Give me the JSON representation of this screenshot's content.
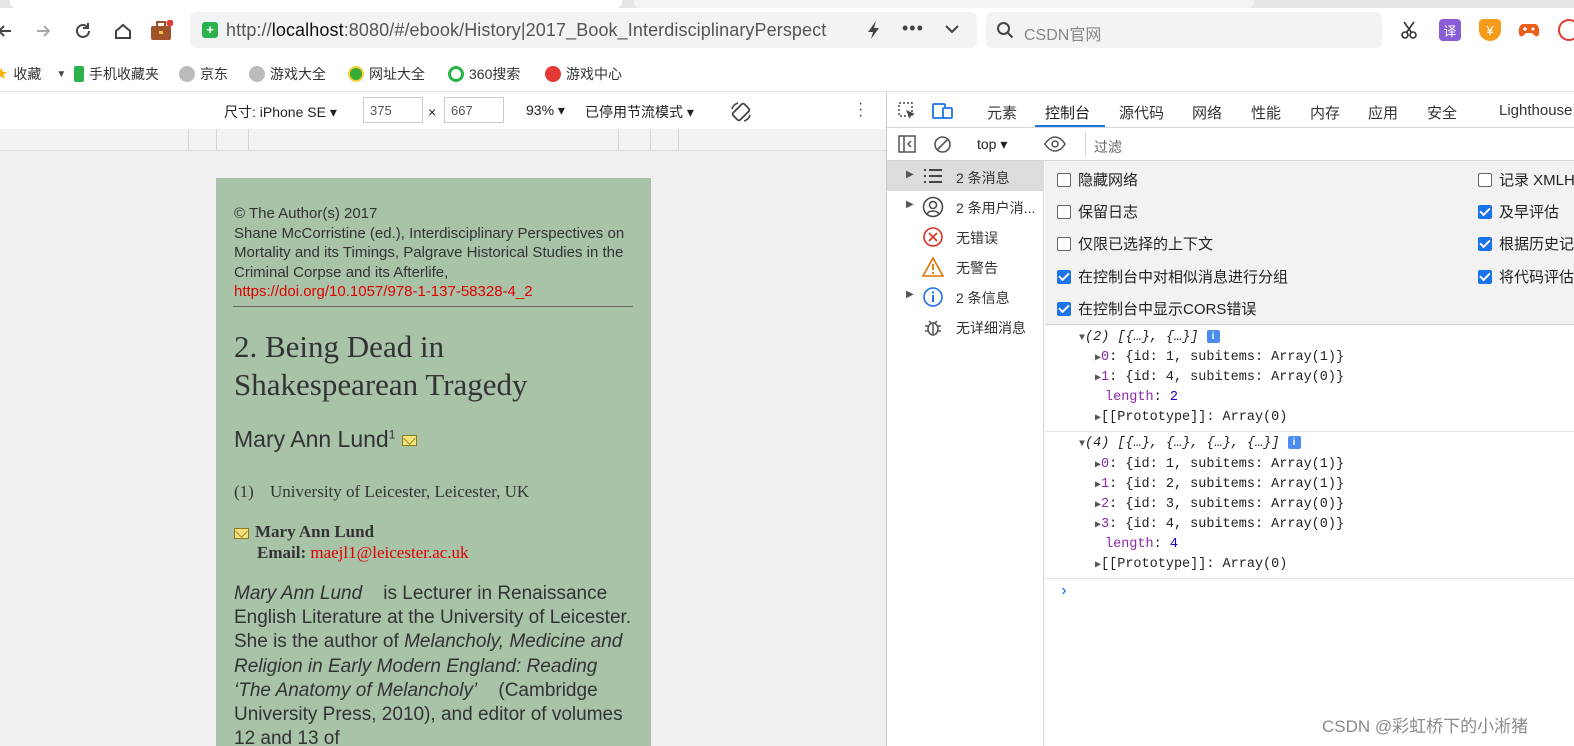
{
  "browser": {
    "url_prefix": "http://",
    "url_host": "localhost",
    "url_rest": ":8080/#/ebook/History|2017_Book_InterdisciplinaryPerspect",
    "search_placeholder": "CSDN官网",
    "ext_translate": "译"
  },
  "bookmarks": [
    "收藏",
    "手机收藏夹",
    "京东",
    "游戏大全",
    "网址大全",
    "360搜索",
    "游戏中心"
  ],
  "device_toolbar": {
    "size_label": "尺寸: iPhone SE ▾",
    "width": "375",
    "x": "×",
    "height": "667",
    "zoom": "93% ▾",
    "throttle": "已停用节流模式 ▾"
  },
  "page": {
    "copyright": "© The Author(s) 2017",
    "citation": "Shane McCorristine (ed.), Interdisciplinary Perspectives on Mortality and its Timings, Palgrave Historical Studies in the Criminal Corpse and its Afterlife,",
    "doi": "https://doi.org/10.1057/978-1-137-58328-4_2",
    "chapter_title": "2. Being Dead in Shakespearean Tragedy",
    "author": "Mary Ann Lund",
    "author_sup": "1",
    "affil_num": "(1)",
    "affiliation": "University of Leicester, Leicester, UK",
    "contact_name": "Mary Ann Lund",
    "email_label": "Email:",
    "email": "maejl1@leicester.ac.uk",
    "bio_name": "Mary Ann Lund",
    "bio_text1": "is Lecturer in Renaissance English Literature at the University of Leicester. She is the author of",
    "bio_book": "Melancholy, Medicine and Religion in Early Modern England: Reading",
    "bio_book2": "‘The Anatomy of Melancholy’",
    "bio_text2": "(Cambridge University Press, 2010), and editor of volumes 12 and 13 of"
  },
  "devtools": {
    "tabs": [
      "元素",
      "控制台",
      "源代码",
      "网络",
      "性能",
      "内存",
      "应用",
      "安全",
      "Lighthouse"
    ],
    "context": "top ▾",
    "filter_placeholder": "过滤",
    "sidebar": [
      "2 条消息",
      "2 条用户消...",
      "无错误",
      "无警告",
      "2 条信息",
      "无详细消息"
    ],
    "settings_left": [
      {
        "label": "隐藏网络",
        "checked": false
      },
      {
        "label": "保留日志",
        "checked": false
      },
      {
        "label": "仅限已选择的上下文",
        "checked": false
      },
      {
        "label": "在控制台中对相似消息进行分组",
        "checked": true
      },
      {
        "label": "在控制台中显示CORS错误",
        "checked": true
      }
    ],
    "settings_right": [
      {
        "label": "记录 XMLH",
        "checked": false
      },
      {
        "label": "及早评估",
        "checked": true
      },
      {
        "label": "根据历史记",
        "checked": true
      },
      {
        "label": "将代码评估",
        "checked": true
      }
    ],
    "log1": {
      "head": "(2) [{…}, {…}]",
      "rows": [
        {
          "k": "0",
          "v": "{id: 1, subitems: Array(1)}"
        },
        {
          "k": "1",
          "v": "{id: 4, subitems: Array(0)}"
        }
      ],
      "length_label": "length",
      "length": "2",
      "proto": "[[Prototype]]: Array(0)"
    },
    "log2": {
      "head": "(4) [{…}, {…}, {…}, {…}]",
      "rows": [
        {
          "k": "0",
          "v": "{id: 1, subitems: Array(1)}"
        },
        {
          "k": "1",
          "v": "{id: 2, subitems: Array(1)}"
        },
        {
          "k": "2",
          "v": "{id: 3, subitems: Array(0)}"
        },
        {
          "k": "3",
          "v": "{id: 4, subitems: Array(0)}"
        }
      ],
      "length_label": "length",
      "length": "4",
      "proto": "[[Prototype]]: Array(0)"
    },
    "prompt": "›"
  },
  "watermark": "CSDN @彩虹桥下的小淅猪",
  "colors": {
    "page_bg": "#a8c3a8",
    "link_red": "#e00000",
    "accent_blue": "#1a73e8"
  },
  "icons": [
    "back-icon",
    "forward-icon",
    "reload-icon",
    "home-icon",
    "briefcase-icon",
    "secure-icon",
    "bolt-icon",
    "more-icon",
    "chevron-down-icon",
    "search-icon",
    "scissors-icon",
    "translate-icon",
    "shield-icon",
    "gamepad-icon"
  ]
}
